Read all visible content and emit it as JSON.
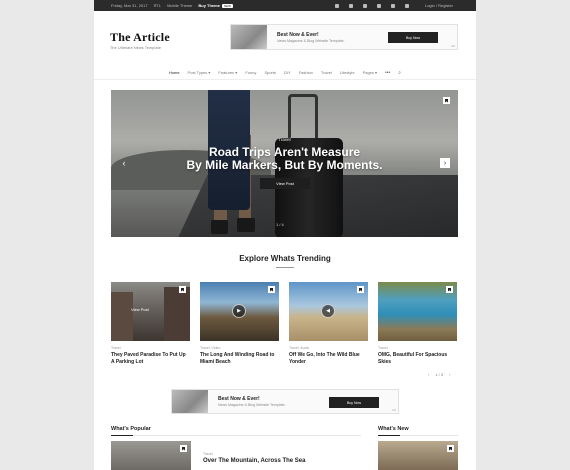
{
  "topbar": {
    "date": "Friday, Mar 31, 2017",
    "rtl": "RTL",
    "mobile": "Mobile Theme",
    "buy": "Buy Theme",
    "badge": "NEW",
    "login": "Login / Register",
    "socials": [
      "facebook-icon",
      "twitter-icon",
      "vimeo-icon",
      "linkedin-icon",
      "pinterest-icon",
      "search-icon"
    ]
  },
  "logo": {
    "title": "The Article",
    "tagline": "The Ultimate News Template"
  },
  "ad": {
    "heading": "Best Now & Ever!",
    "text": "News Magazine & Blog Website Template.",
    "button": "Buy Now",
    "tag": "AD"
  },
  "nav": {
    "items": [
      "Home",
      "Post Types",
      "Features",
      "Funny",
      "Sports",
      "DIY",
      "Fashion",
      "Travel",
      "Lifestyle",
      "Pages"
    ],
    "more": "•••",
    "search": "⌕"
  },
  "hero": {
    "category": "Travel",
    "title_line1": "Road Trips Aren't Measure",
    "title_line2": "By Mile Markers, But By Moments.",
    "button": "View Post",
    "counter": "1 / 4"
  },
  "trending": {
    "title": "Explore Whats Trending",
    "cards": [
      {
        "meta": "Travel",
        "title": "They Paved Paradise To Put Up A Parking Lot",
        "overlay": "View Post"
      },
      {
        "meta": "Travel, Video",
        "title": "The Long And Winding Road to Miami Beach"
      },
      {
        "meta": "Travel, Audio",
        "title": "Off We Go, Into The Wild Blue Yonder"
      },
      {
        "meta": "Travel",
        "title": "OMG, Beautiful For Spacious Skies"
      }
    ],
    "pager": {
      "prev": "‹",
      "label": "1 / 3",
      "next": "›"
    }
  },
  "popular": {
    "title": "What's Popular",
    "meta": "Travel",
    "post_title": "Over The Mountain, Across The Sea"
  },
  "whatsnew": {
    "title": "What's New"
  }
}
